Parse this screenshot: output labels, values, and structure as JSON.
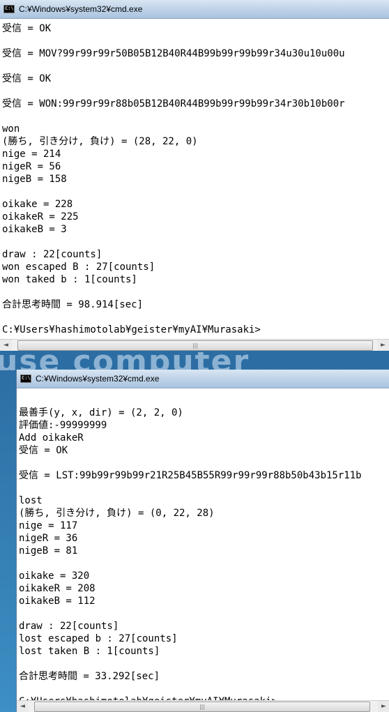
{
  "background": {
    "watermark_text": "use computer"
  },
  "window1": {
    "title": "C:¥Windows¥system32¥cmd.exe",
    "lines": [
      "受信 = OK",
      "",
      "受信 = MOV?99r99r99r50B05B12B40R44B99b99r99b99r34u30u10u00u",
      "",
      "受信 = OK",
      "",
      "受信 = WON:99r99r99r88b05B12B40R44B99b99r99b99r34r30b10b00r",
      "",
      "won",
      "(勝ち, 引き分け, 負け) = (28, 22, 0)",
      "nige = 214",
      "nigeR = 56",
      "nigeB = 158",
      "",
      "oikake = 228",
      "oikakeR = 225",
      "oikakeB = 3",
      "",
      "draw : 22[counts]",
      "won escaped B : 27[counts]",
      "won taked b : 1[counts]",
      "",
      "合計思考時間 = 98.914[sec]",
      "",
      "C:¥Users¥hashimotolab¥geister¥myAI¥Murasaki>"
    ]
  },
  "window2": {
    "title": "C:¥Windows¥system32¥cmd.exe",
    "lines": [
      "",
      "最善手(y, x, dir) = (2, 2, 0)",
      "評価値:-99999999",
      "Add oikakeR",
      "受信 = OK",
      "",
      "受信 = LST:99b99r99b99r21R25B45B55R99r99r99r88b50b43b15r11b",
      "",
      "lost",
      "(勝ち, 引き分け, 負け) = (0, 22, 28)",
      "nige = 117",
      "nigeR = 36",
      "nigeB = 81",
      "",
      "oikake = 320",
      "oikakeR = 208",
      "oikakeB = 112",
      "",
      "draw : 22[counts]",
      "lost escaped b : 27[counts]",
      "lost taken B : 1[counts]",
      "",
      "合計思考時間 = 33.292[sec]",
      "",
      "C:¥Users¥hashimotolab¥geister¥myAI¥Murasaki>"
    ]
  },
  "scrollbar": {
    "left_arrow": "◄",
    "right_arrow": "►",
    "grip": "|||"
  }
}
